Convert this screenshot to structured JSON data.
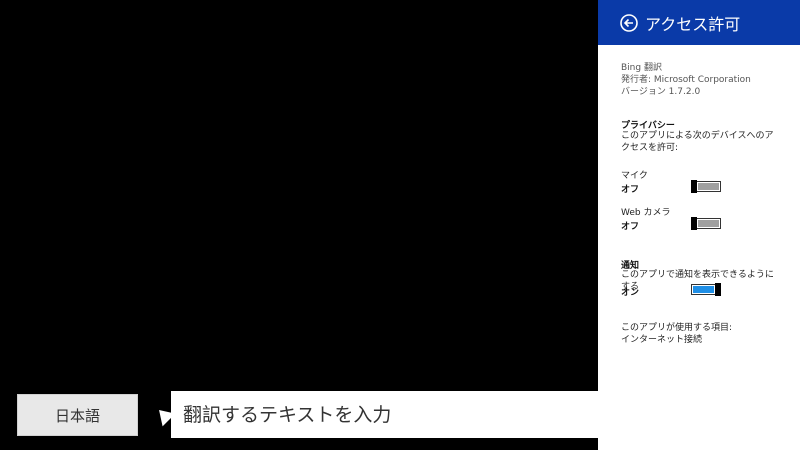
{
  "app": {
    "language_button": "日本語",
    "input_placeholder": "翻訳するテキストを入力",
    "mic_icon": "microphone-icon",
    "camera_icon": "camera-icon"
  },
  "pane": {
    "title": "アクセス許可",
    "app_name": "Bing 翻訳",
    "publisher": "発行者: Microsoft Corporation",
    "version": "バージョン 1.7.2.0",
    "privacy": {
      "title": "プライバシー",
      "description": "このアプリによる次のデバイスへのアクセスを許可:",
      "mic_label": "マイク",
      "mic_state": "オフ",
      "webcam_label": "Web カメラ",
      "webcam_state": "オフ"
    },
    "notifications": {
      "title": "通知",
      "description": "このアプリで通知を表示できるようにする",
      "state": "オン"
    },
    "uses_title": "このアプリが使用する項目:",
    "uses_item": "インターネット接続",
    "header_color": "#0a3aa8",
    "toggle_on_color": "#1f8fe6"
  }
}
